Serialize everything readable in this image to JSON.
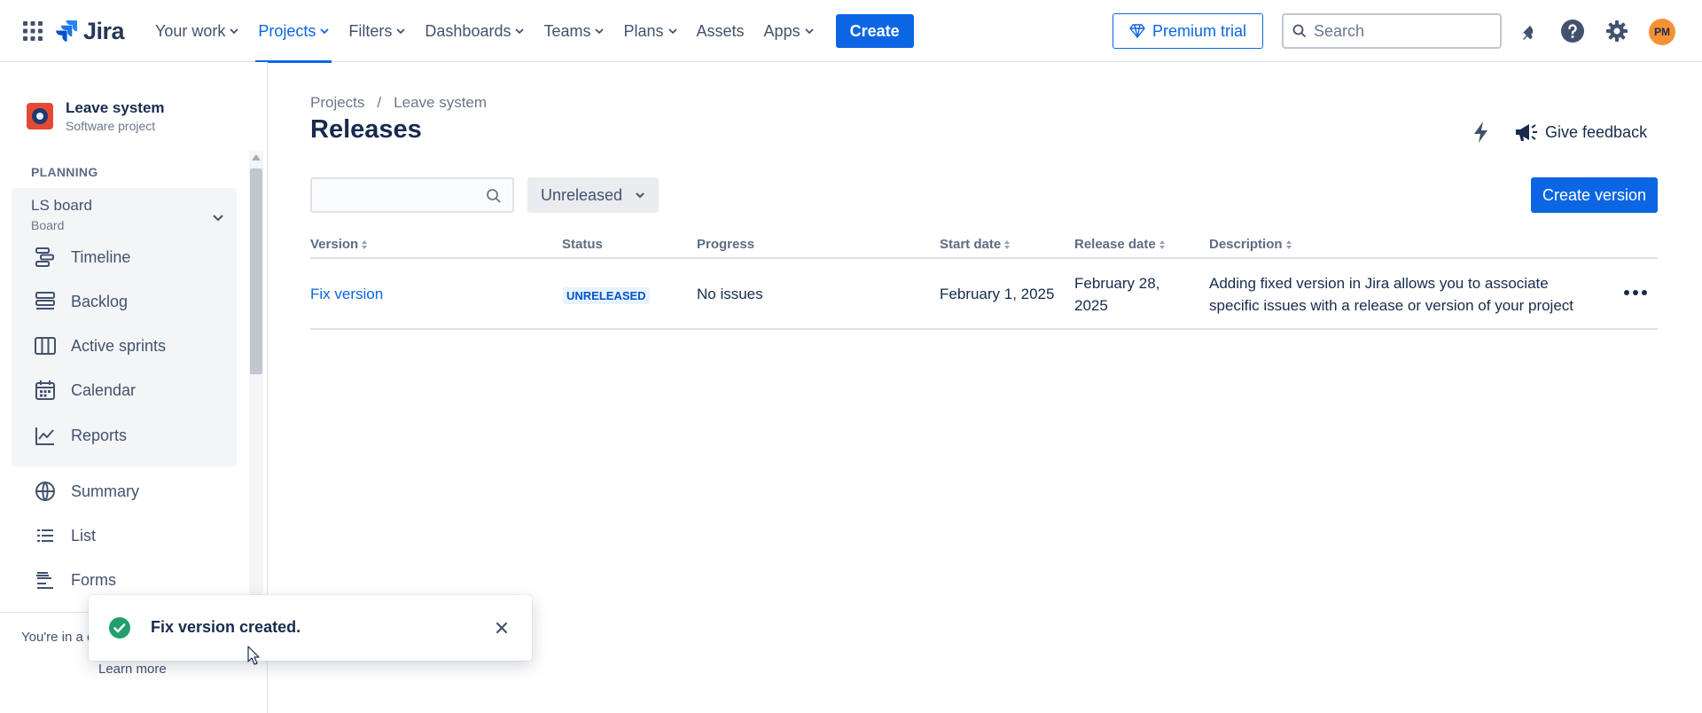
{
  "topnav": {
    "logo_text": "Jira",
    "items": [
      {
        "label": "Your work",
        "dropdown": true
      },
      {
        "label": "Projects",
        "dropdown": true,
        "active": true
      },
      {
        "label": "Filters",
        "dropdown": true
      },
      {
        "label": "Dashboards",
        "dropdown": true
      },
      {
        "label": "Teams",
        "dropdown": true
      },
      {
        "label": "Plans",
        "dropdown": true
      },
      {
        "label": "Assets",
        "dropdown": false
      },
      {
        "label": "Apps",
        "dropdown": true
      }
    ],
    "create_label": "Create",
    "premium_label": "Premium trial",
    "search_placeholder": "Search",
    "avatar_initials": "PM"
  },
  "sidebar": {
    "project_name": "Leave system",
    "project_type": "Software project",
    "section_label": "PLANNING",
    "board_name": "LS board",
    "board_sub": "Board",
    "planning_items": [
      "Timeline",
      "Backlog",
      "Active sprints",
      "Calendar",
      "Reports"
    ],
    "other_items": [
      "Summary",
      "List",
      "Forms"
    ],
    "footer_text": "You're in a c",
    "learn_more": "Learn more"
  },
  "main": {
    "breadcrumb": [
      "Projects",
      "Leave system"
    ],
    "breadcrumb_sep": "/",
    "title": "Releases",
    "feedback_label": "Give feedback",
    "status_filter": "Unreleased",
    "create_version_label": "Create version",
    "columns": [
      "Version",
      "Status",
      "Progress",
      "Start date",
      "Release date",
      "Description"
    ],
    "rows": [
      {
        "version": "Fix version",
        "status": "UNRELEASED",
        "progress": "No issues",
        "start_date": "February 1, 2025",
        "release_date_line1": "February 28,",
        "release_date_line2": "2025",
        "description_line1": "Adding fixed version in Jira allows you to associate",
        "description_line2": "specific issues with a release or version of your project"
      }
    ]
  },
  "toast": {
    "message": "Fix version created."
  },
  "colors": {
    "brand": "#0c66e4",
    "success": "#22a06b",
    "text": "#172b4d"
  }
}
